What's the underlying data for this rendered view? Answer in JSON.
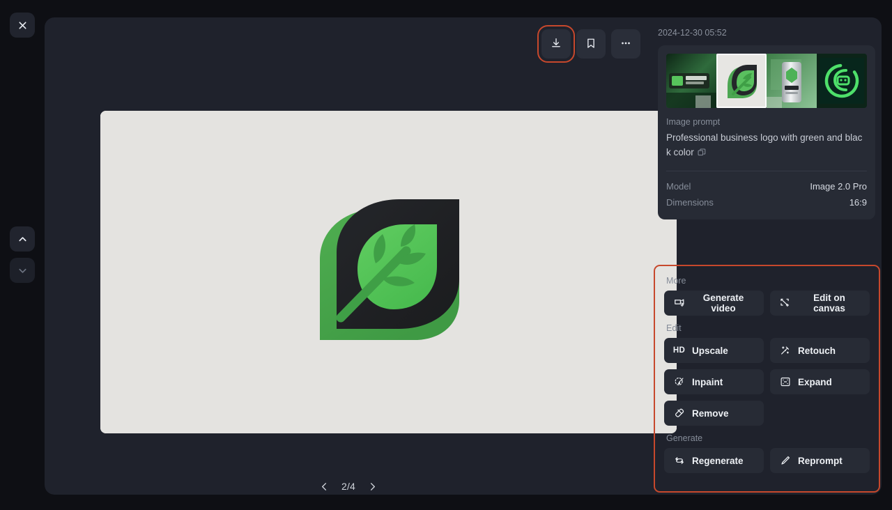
{
  "rail": {
    "close_label": "Close",
    "prev_label": "Previous",
    "next_label": "Next"
  },
  "toolbar": {
    "download_label": "Download",
    "bookmark_label": "Bookmark",
    "more_label": "More options"
  },
  "viewer": {
    "pager_text": "2/4",
    "prev_arrow": "‹",
    "next_arrow": "›"
  },
  "info": {
    "timestamp": "2024-12-30 05:52",
    "prompt_label": "Image prompt",
    "prompt_text": "Professional business logo with green and black color",
    "rows": [
      {
        "key": "Model",
        "value": "Image 2.0 Pro"
      },
      {
        "key": "Dimensions",
        "value": "16:9"
      }
    ],
    "thumbnails": [
      {
        "name": "thumb-keyboard-logo",
        "selected": false
      },
      {
        "name": "thumb-leaf-logo",
        "selected": true
      },
      {
        "name": "thumb-espert-can",
        "selected": false
      },
      {
        "name": "thumb-circle-monogram",
        "selected": false
      }
    ]
  },
  "more_panel": {
    "groups": [
      {
        "label": "More",
        "buttons": [
          {
            "label": "Generate video",
            "icon": "video-frame-plus-icon"
          },
          {
            "label": "Edit on canvas",
            "icon": "canvas-frame-plus-icon"
          }
        ]
      },
      {
        "label": "Edit",
        "buttons": [
          {
            "label": "Upscale",
            "icon": "hd-icon"
          },
          {
            "label": "Retouch",
            "icon": "magic-wand-icon"
          },
          {
            "label": "Inpaint",
            "icon": "brush-circle-icon"
          },
          {
            "label": "Expand",
            "icon": "expand-frame-icon"
          },
          {
            "label": "Remove",
            "icon": "eraser-icon"
          }
        ]
      },
      {
        "label": "Generate",
        "buttons": [
          {
            "label": "Regenerate",
            "icon": "refresh-arrows-icon"
          },
          {
            "label": "Reprompt",
            "icon": "pencil-icon"
          }
        ]
      }
    ]
  },
  "colors": {
    "page_bg": "#0e0f14",
    "panel_bg": "#1f222c",
    "card_bg": "#272b35",
    "accent_highlight": "#c7482c",
    "logo_green": "#4fc25a",
    "logo_dark": "#1f2022",
    "paper": "#e4e3e0"
  }
}
